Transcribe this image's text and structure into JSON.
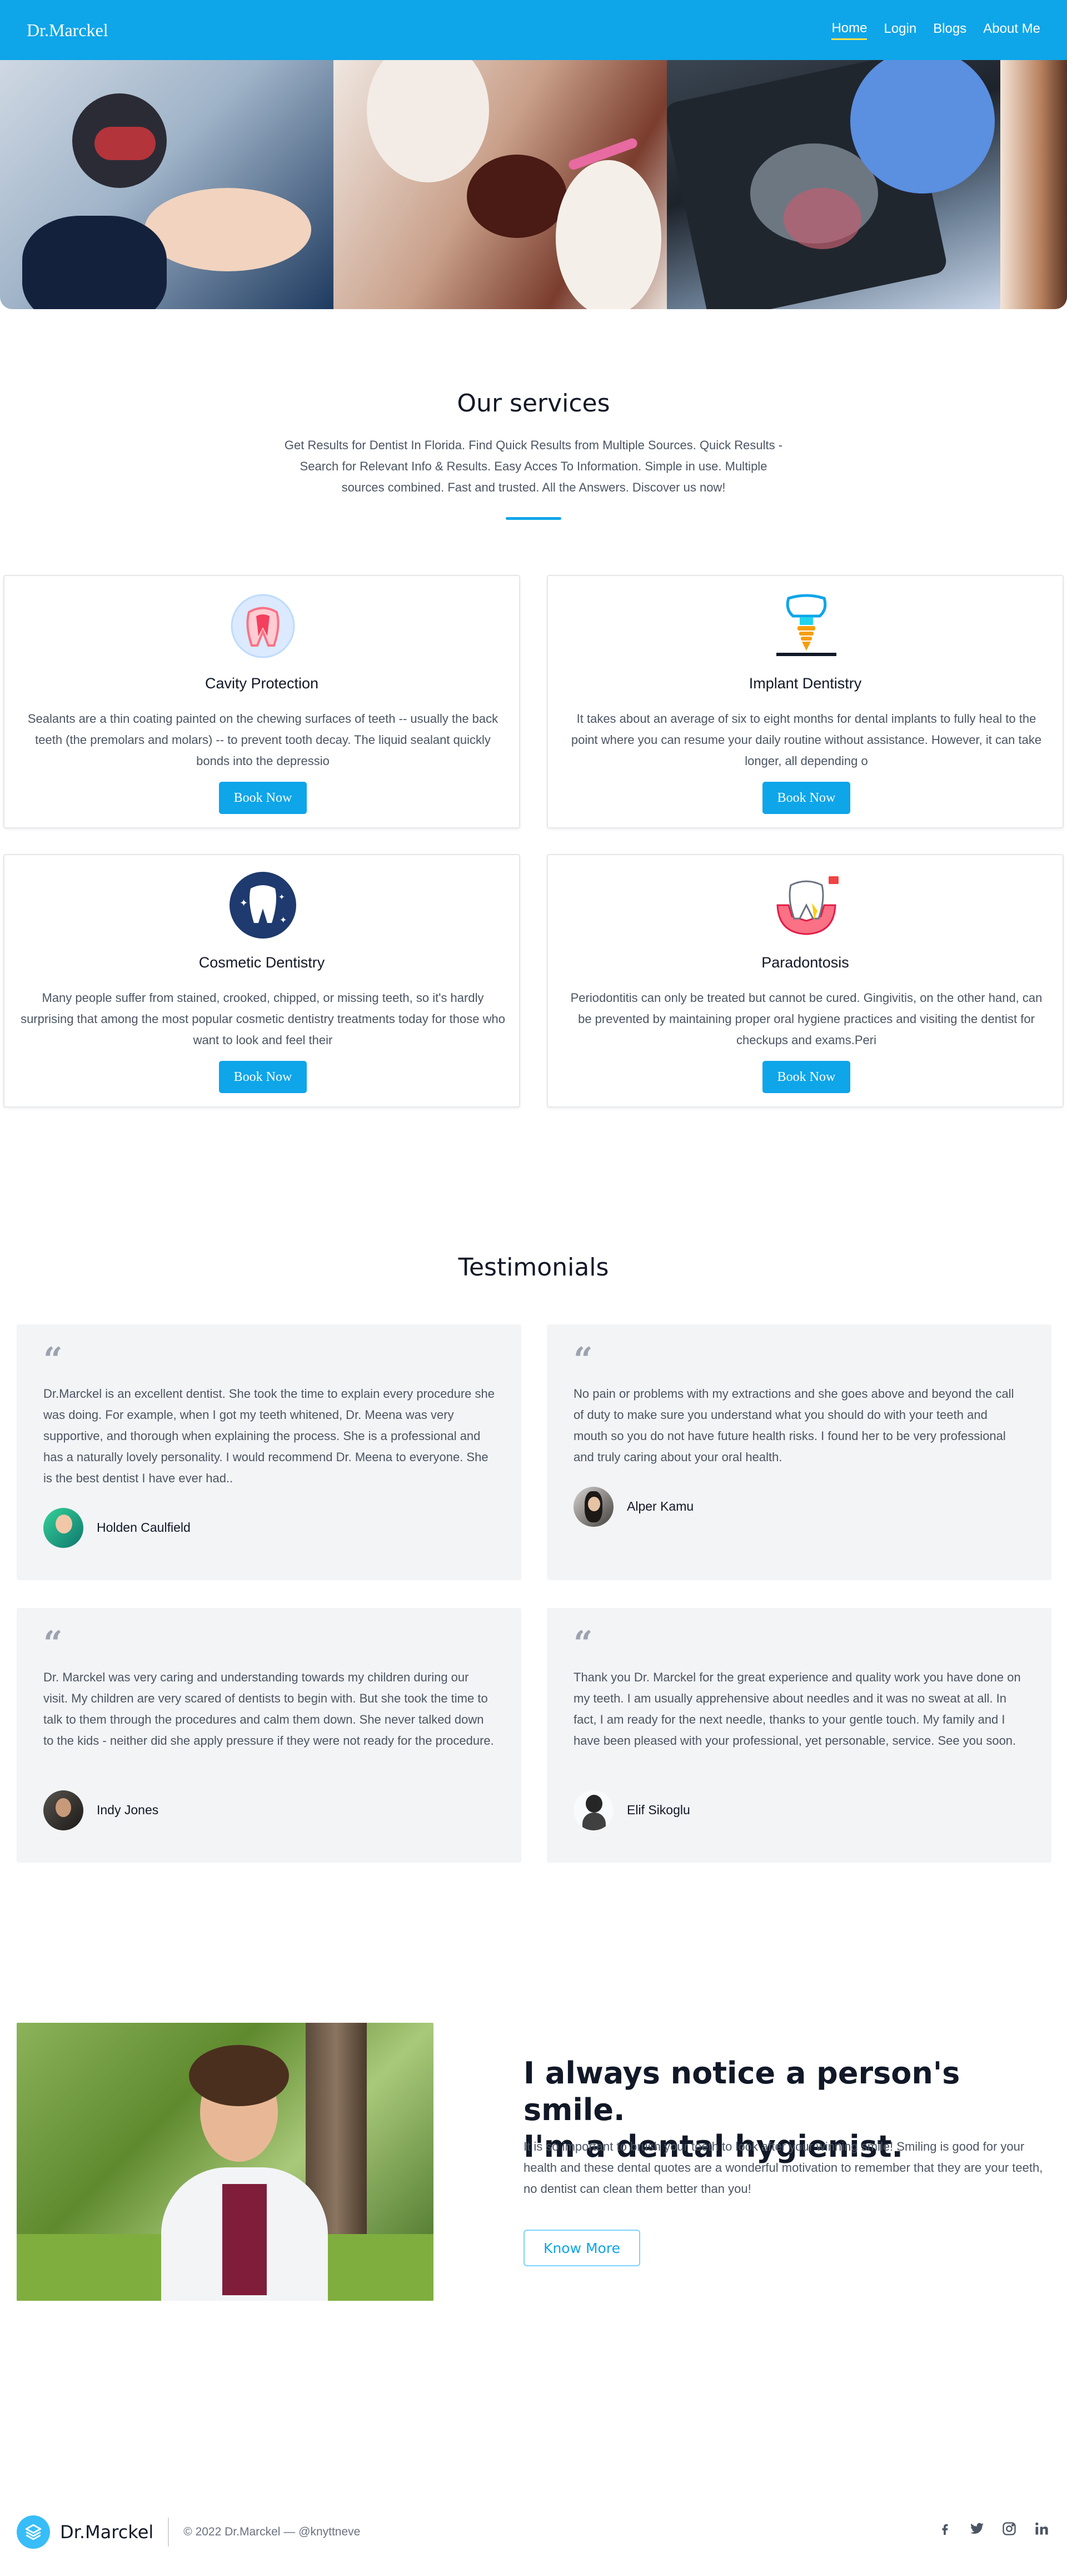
{
  "nav": {
    "brand": "Dr.Marckel",
    "links": [
      "Home",
      "Login",
      "Blogs",
      "About Me"
    ],
    "active": "Home"
  },
  "hero": {
    "images": [
      "dentist-at-work-image",
      "dental-exam-image",
      "dental-xray-tablet-image",
      "smiling-woman-image"
    ]
  },
  "services": {
    "title": "Our services",
    "description": "Get Results for Dentist In Florida. Find Quick Results from Multiple Sources. Quick Results - Search for Relevant Info & Results. Easy Acces To Information. Simple in use. Multiple sources combined. Fast and trusted. All the Answers. Discover us now!",
    "items": [
      {
        "title": "Cavity Protection",
        "text": "Sealants are a thin coating painted on the chewing surfaces of teeth -- usually the back teeth (the premolars and molars) -- to prevent tooth decay. The liquid sealant quickly bonds into the depressio",
        "button": "Book Now",
        "icon": "tooth-cross-section-icon"
      },
      {
        "title": "Implant Dentistry",
        "text": "It takes about an average of six to eight months for dental implants to fully heal to the point where you can resume your daily routine without assistance. However, it can take longer, all depending o",
        "button": "Book Now",
        "icon": "dental-implant-icon"
      },
      {
        "title": "Cosmetic Dentistry",
        "text": "Many people suffer from stained, crooked, chipped, or missing teeth, so it's hardly surprising that among the most popular cosmetic dentistry treatments today for those who want to look and feel their",
        "button": "Book Now",
        "icon": "sparkling-tooth-icon"
      },
      {
        "title": "Paradontosis",
        "text": "Periodontitis can only be treated but cannot be cured. Gingivitis, on the other hand, can be prevented by maintaining proper oral hygiene practices and visiting the dentist for checkups and exams.Peri",
        "button": "Book Now",
        "icon": "gum-disease-tooth-icon"
      }
    ]
  },
  "testimonials": {
    "title": "Testimonials",
    "items": [
      {
        "text": "Dr.Marckel is an excellent dentist. She took the time to explain every procedure she was doing. For example, when I got my teeth whitened, Dr. Meena was very supportive, and thorough when explaining the process. She is a professional and has a naturally lovely personality. I would recommend Dr. Meena to everyone. She is the best dentist I have ever had..",
        "name": "Holden Caulfield"
      },
      {
        "text": "No pain or problems with my extractions and she goes above and beyond the call of duty to make sure you understand what you should do with your teeth and mouth so you do not have future health risks. I found her to be very professional and truly caring about your oral health.",
        "name": "Alper Kamu"
      },
      {
        "text": "Dr. Marckel was very caring and understanding towards my children during our visit. My children are very scared of dentists to begin with. But she took the time to talk to them through the procedures and calm them down. She never talked down to the kids - neither did she apply pressure if they were not ready for the procedure.",
        "name": "Indy Jones"
      },
      {
        "text": "Thank you Dr. Marckel for the great experience and quality work you have done on my teeth. I am usually apprehensive about needles and it was no sweat at all. In fact, I am ready for the next needle, thanks to your gentle touch. My family and I have been pleased with your professional, yet personable, service. See you soon.",
        "name": "Elif Sikoglu"
      }
    ]
  },
  "smile": {
    "heading_line1": "I always notice a person's smile.",
    "heading_line2": "I'm a dental hygienist.",
    "text": "It is so important to brush your teeth to look after your winning smile! Smiling is good for your health and these dental quotes are a wonderful motivation to remember that they are your teeth, no dentist can clean them better than you!",
    "button": "Know More"
  },
  "footer": {
    "brand": "Dr.Marckel",
    "copyright": "© 2022 Dr.Marckel — @knyttneve",
    "socials": [
      "facebook-icon",
      "twitter-icon",
      "instagram-icon",
      "linkedin-icon"
    ]
  },
  "colors": {
    "primary": "#0ea5e9",
    "nav_underline": "#fde047",
    "card_bg": "#f3f4f6",
    "text_muted": "#4b5563"
  }
}
